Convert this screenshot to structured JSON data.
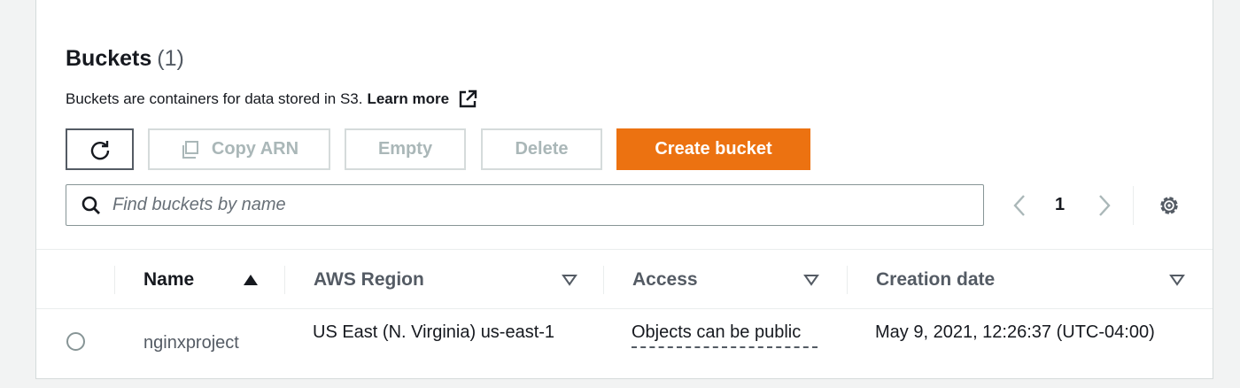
{
  "header": {
    "title": "Buckets",
    "count": "(1)",
    "description": "Buckets are containers for data stored in S3.",
    "learn_more": "Learn more"
  },
  "toolbar": {
    "copy_arn_label": "Copy ARN",
    "empty_label": "Empty",
    "delete_label": "Delete",
    "create_label": "Create bucket"
  },
  "search": {
    "placeholder": "Find buckets by name",
    "value": ""
  },
  "pagination": {
    "current_page": "1"
  },
  "table": {
    "columns": [
      {
        "label": "Name",
        "sort": "ascending"
      },
      {
        "label": "AWS Region",
        "sort": "none"
      },
      {
        "label": "Access",
        "sort": "none"
      },
      {
        "label": "Creation date",
        "sort": "none"
      }
    ],
    "rows": [
      {
        "name": "nginxproject",
        "region": "US East (N. Virginia) us-east-1",
        "access": "Objects can be public",
        "created": "May 9, 2021, 12:26:37 (UTC-04:00)"
      }
    ]
  },
  "colors": {
    "accent": "#ec7211",
    "text": "#16191f",
    "muted": "#545b64",
    "disabled": "#aab7b8"
  }
}
